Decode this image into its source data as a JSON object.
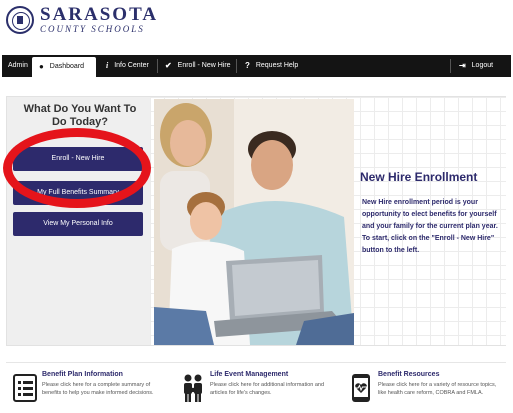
{
  "header": {
    "logo_title": "SARASOTA",
    "logo_subtitle": "COUNTY SCHOOLS"
  },
  "nav": {
    "admin": "Admin",
    "dashboard": "Dashboard",
    "info_center": "Info Center",
    "enroll_new_hire": "Enroll - New Hire",
    "request_help": "Request Help",
    "logout": "Logout"
  },
  "sidebar": {
    "question": "What Do You Want To Do Today?",
    "buttons": [
      "Enroll - New Hire",
      "My Full Benefits Summary",
      "View My Personal Info"
    ]
  },
  "hero": {
    "title": "New Hire Enrollment",
    "text": "New Hire enrollment period is your opportunity to elect benefits for yourself and your family for the current plan year. To start, click on the \"Enroll - New Hire\" button to the left."
  },
  "cards": [
    {
      "title": "Benefit Plan Information",
      "desc": "Please click here for a complete summary of benefits to help you make informed decisions.",
      "icon": "document-list-icon"
    },
    {
      "title": "Life Event Management",
      "desc": "Please click here for additional information and articles for life's changes.",
      "icon": "family-icon"
    },
    {
      "title": "Benefit Resources",
      "desc": "Please click here for a variety of resource topics, like health care reform, COBRA and FMLA.",
      "icon": "phone-heart-icon"
    }
  ],
  "colors": {
    "brand": "#2d2a6c",
    "nav_bg": "#141414",
    "annotation": "#e5141b"
  }
}
